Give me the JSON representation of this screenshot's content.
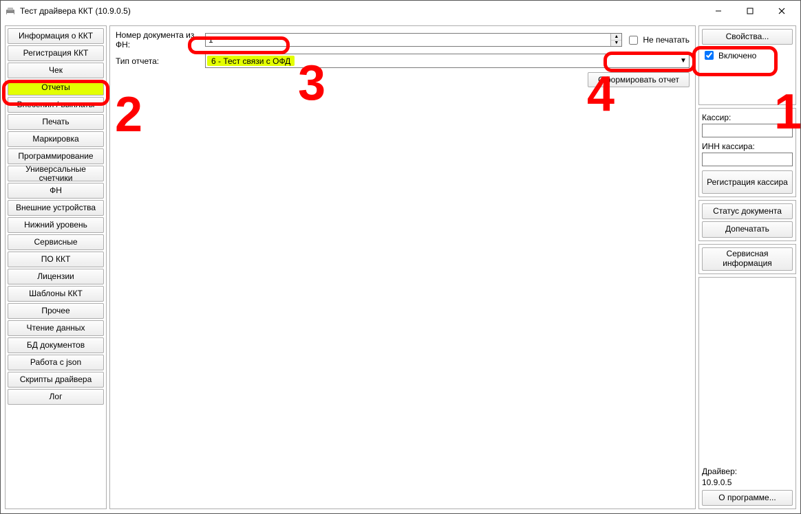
{
  "title": "Тест драйвера ККТ (10.9.0.5)",
  "sidebar": {
    "items": [
      {
        "label": "Информация о ККТ"
      },
      {
        "label": "Регистрация ККТ"
      },
      {
        "label": "Чек"
      },
      {
        "label": "Отчеты"
      },
      {
        "label": "Внесения / выплаты"
      },
      {
        "label": "Печать"
      },
      {
        "label": "Маркировка"
      },
      {
        "label": "Программирование"
      },
      {
        "label": "Универсальные счетчики"
      },
      {
        "label": "ФН"
      },
      {
        "label": "Внешние устройства"
      },
      {
        "label": "Нижний уровень"
      },
      {
        "label": "Сервисные"
      },
      {
        "label": "ПО ККТ"
      },
      {
        "label": "Лицензии"
      },
      {
        "label": "Шаблоны ККТ"
      },
      {
        "label": "Прочее"
      },
      {
        "label": "Чтение данных"
      },
      {
        "label": "БД документов"
      },
      {
        "label": "Работа с json"
      },
      {
        "label": "Скрипты драйвера"
      },
      {
        "label": "Лог"
      }
    ],
    "active_index": 3
  },
  "main": {
    "doc_label": "Номер документа из ФН:",
    "doc_value": "1",
    "noprint_label": "Не печатать",
    "type_label": "Тип отчета:",
    "type_value": "6 - Тест связи с ОФД",
    "generate_label": "Сформировать отчет"
  },
  "right": {
    "properties_btn": "Свойства...",
    "enabled_label": "Включено",
    "cashier_label": "Кассир:",
    "cashier_inn_label": "ИНН кассира:",
    "reg_cashier_btn": "Регистрация кассира",
    "doc_status_btn": "Статус документа",
    "reprint_btn": "Допечатать",
    "service_info_btn": "Сервисная информация",
    "driver_label": "Драйвер:",
    "driver_version": "10.9.0.5",
    "about_btn": "О программе..."
  },
  "annotations": {
    "n1": "1",
    "n2": "2",
    "n3": "3",
    "n4": "4"
  }
}
